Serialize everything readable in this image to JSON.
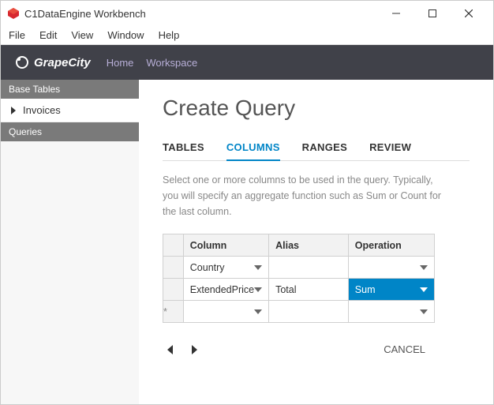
{
  "window": {
    "title": "C1DataEngine Workbench"
  },
  "menubar": {
    "file": "File",
    "edit": "Edit",
    "view": "View",
    "window": "Window",
    "help": "Help"
  },
  "brandbar": {
    "brand": "GrapeCity",
    "home": "Home",
    "workspace": "Workspace"
  },
  "sidebar": {
    "base_tables_header": "Base Tables",
    "invoices": "Invoices",
    "queries_header": "Queries"
  },
  "page": {
    "title": "Create Query",
    "help_text": "Select one or more columns to be used in the query. Typically, you will specify an aggregate function such as Sum or Count for the last column."
  },
  "tabs": {
    "tables": "TABLES",
    "columns": "COLUMNS",
    "ranges": "RANGES",
    "review": "REVIEW"
  },
  "grid": {
    "headers": {
      "column": "Column",
      "alias": "Alias",
      "operation": "Operation"
    },
    "rows": [
      {
        "column": "Country",
        "alias": "",
        "operation": ""
      },
      {
        "column": "ExtendedPrice",
        "alias": "Total",
        "operation": "Sum"
      },
      {
        "column": "",
        "alias": "",
        "operation": ""
      }
    ],
    "new_row_marker": "*"
  },
  "buttons": {
    "cancel": "CANCEL"
  }
}
